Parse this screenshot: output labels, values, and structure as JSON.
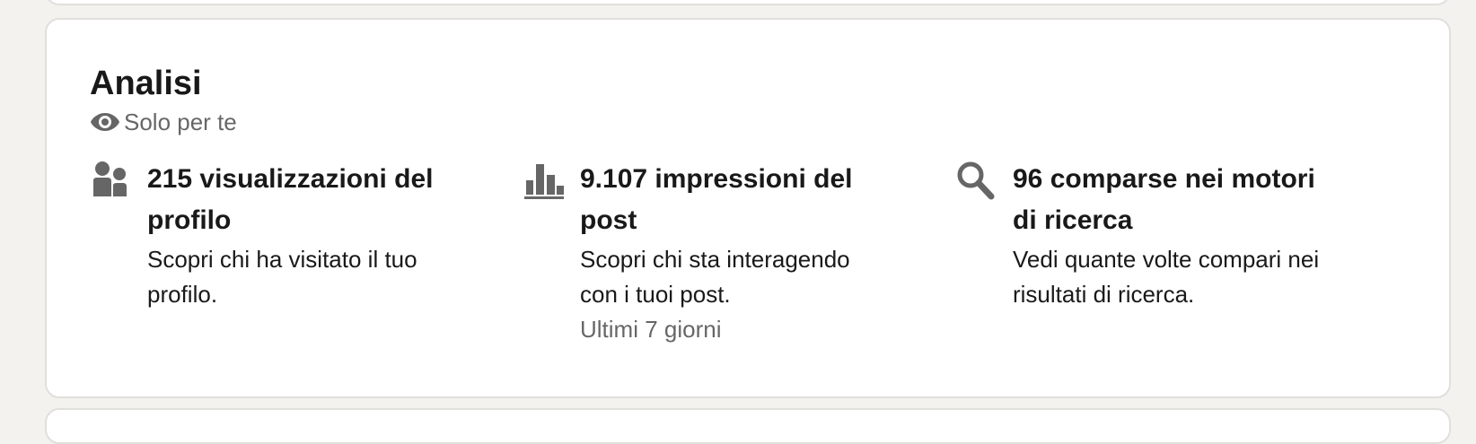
{
  "analytics": {
    "title": "Analisi",
    "privacy_icon": "eye-icon",
    "privacy_label": "Solo per te",
    "metrics": [
      {
        "icon": "people-icon",
        "title_line1": "215 visualizzazioni del",
        "title_line2": "profilo",
        "desc_line1": "Scopri chi ha visitato il tuo",
        "desc_line2": "profilo.",
        "sub": ""
      },
      {
        "icon": "bar-chart-icon",
        "title_line1": "9.107 impressioni del",
        "title_line2": "post",
        "desc_line1": "Scopri chi sta interagendo",
        "desc_line2": "con i tuoi post.",
        "sub": "Ultimi 7 giorni"
      },
      {
        "icon": "search-icon",
        "title_line1": "96 comparse nei motori",
        "title_line2": "di ricerca",
        "desc_line1": "Vedi quante volte compari nei",
        "desc_line2": "risultati di ricerca.",
        "sub": ""
      }
    ]
  },
  "colors": {
    "page_bg": "#f4f2ee",
    "card_bg": "#ffffff",
    "icon_gray": "#666666"
  }
}
